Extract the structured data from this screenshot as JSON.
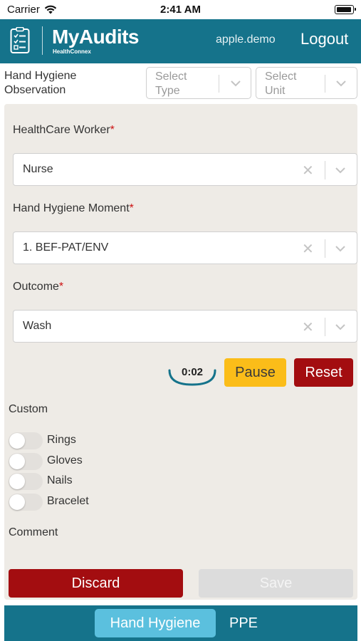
{
  "status_bar": {
    "carrier": "Carrier",
    "time": "2:41 AM"
  },
  "header": {
    "logo_text": "MyAudits",
    "logo_subtext": "HealthConnex",
    "username": "apple.demo",
    "logout_label": "Logout",
    "color": "#15738b"
  },
  "filters": {
    "title": "Hand Hygiene Observation",
    "type_placeholder": "Select Type",
    "unit_placeholder": "Select Unit"
  },
  "form": {
    "healthcare_worker": {
      "label": "HealthCare Worker",
      "required_mark": "*",
      "value": "Nurse"
    },
    "moment": {
      "label": "Hand Hygiene Moment",
      "required_mark": "*",
      "value": "1. BEF-PAT/ENV"
    },
    "outcome": {
      "label": "Outcome",
      "required_mark": "*",
      "value": "Wash"
    },
    "clear_glyph": "✕",
    "timer": {
      "value": "0:02"
    },
    "pause_label": "Pause",
    "reset_label": "Reset",
    "custom_label": "Custom",
    "toggles": [
      {
        "label": "Rings",
        "on": false
      },
      {
        "label": "Gloves",
        "on": false
      },
      {
        "label": "Nails",
        "on": false
      },
      {
        "label": "Bracelet",
        "on": false
      }
    ],
    "comment_label": "Comment",
    "discard_label": "Discard",
    "save_label": "Save"
  },
  "tabs": [
    {
      "label": "Hand Hygiene",
      "active": true
    },
    {
      "label": "PPE",
      "active": false
    }
  ],
  "colors": {
    "primary": "#15738b",
    "danger": "#a30d10",
    "warning": "#fbbd19",
    "tab_active": "#5bc0de",
    "panel": "#eeebe6"
  }
}
